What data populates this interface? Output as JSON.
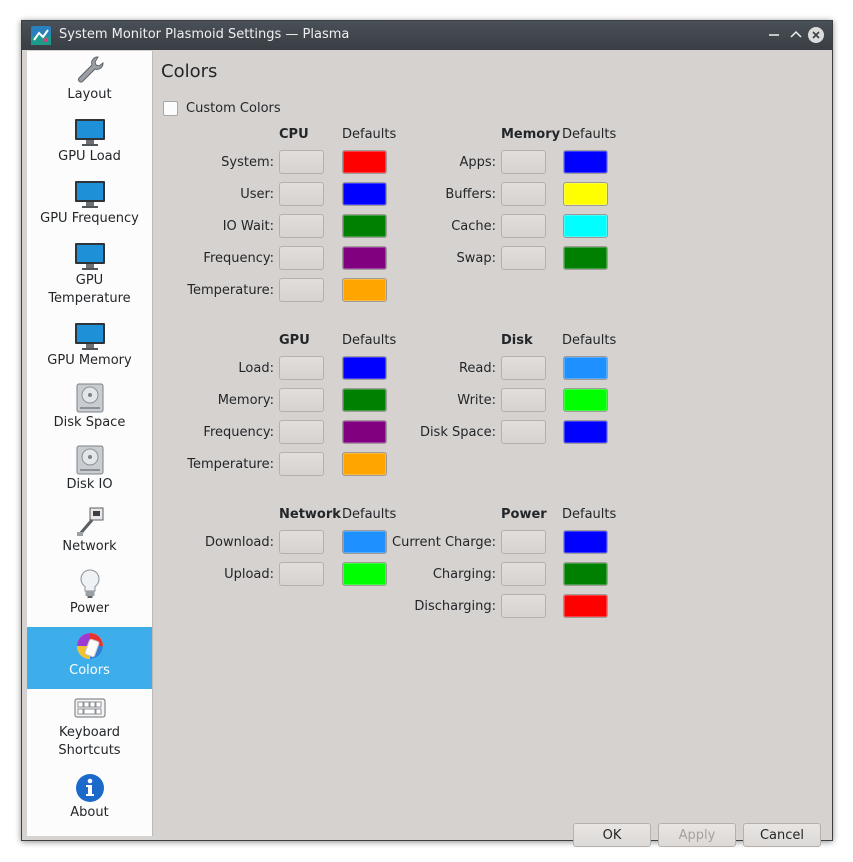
{
  "window": {
    "title": "System Monitor Plasmoid Settings — Plasma"
  },
  "sidebar": {
    "items": [
      {
        "label": "Layout",
        "icon": "wrench-icon",
        "active": false
      },
      {
        "label": "GPU Load",
        "icon": "monitor-icon",
        "active": false
      },
      {
        "label": "GPU Frequency",
        "icon": "monitor-icon",
        "active": false
      },
      {
        "label": "GPU\nTemperature",
        "icon": "monitor-icon",
        "active": false
      },
      {
        "label": "GPU Memory",
        "icon": "monitor-icon",
        "active": false
      },
      {
        "label": "Disk Space",
        "icon": "hard-drive-icon",
        "active": false
      },
      {
        "label": "Disk IO",
        "icon": "hard-drive-icon",
        "active": false
      },
      {
        "label": "Network",
        "icon": "network-cable-icon",
        "active": false
      },
      {
        "label": "Power",
        "icon": "lightbulb-icon",
        "active": false
      },
      {
        "label": "Colors",
        "icon": "color-palette-icon",
        "active": true
      },
      {
        "label": "Keyboard\nShortcuts",
        "icon": "keyboard-icon",
        "active": false
      },
      {
        "label": "About",
        "icon": "info-icon",
        "active": false
      }
    ]
  },
  "main": {
    "title": "Colors",
    "custom_colors_label": "Custom Colors",
    "custom_colors_checked": false,
    "defaults_header": "Defaults",
    "groups": {
      "cpu": {
        "header": "CPU",
        "rows": [
          {
            "label": "System:",
            "default_color": "#ff0000"
          },
          {
            "label": "User:",
            "default_color": "#0000ff"
          },
          {
            "label": "IO Wait:",
            "default_color": "#008000"
          },
          {
            "label": "Frequency:",
            "default_color": "#800080"
          },
          {
            "label": "Temperature:",
            "default_color": "#ffa500"
          }
        ]
      },
      "memory": {
        "header": "Memory",
        "rows": [
          {
            "label": "Apps:",
            "default_color": "#0000ff"
          },
          {
            "label": "Buffers:",
            "default_color": "#ffff00"
          },
          {
            "label": "Cache:",
            "default_color": "#00ffff"
          },
          {
            "label": "Swap:",
            "default_color": "#008000"
          }
        ]
      },
      "gpu": {
        "header": "GPU",
        "rows": [
          {
            "label": "Load:",
            "default_color": "#0000ff"
          },
          {
            "label": "Memory:",
            "default_color": "#008000"
          },
          {
            "label": "Frequency:",
            "default_color": "#800080"
          },
          {
            "label": "Temperature:",
            "default_color": "#ffa500"
          }
        ]
      },
      "disk": {
        "header": "Disk",
        "rows": [
          {
            "label": "Read:",
            "default_color": "#1e90ff"
          },
          {
            "label": "Write:",
            "default_color": "#00ff00"
          },
          {
            "label": "Disk Space:",
            "default_color": "#0000ff"
          }
        ]
      },
      "network": {
        "header": "Network",
        "rows": [
          {
            "label": "Download:",
            "default_color": "#1e90ff"
          },
          {
            "label": "Upload:",
            "default_color": "#00ff00"
          }
        ]
      },
      "power": {
        "header": "Power",
        "rows": [
          {
            "label": "Current Charge:",
            "default_color": "#0000ff"
          },
          {
            "label": "Charging:",
            "default_color": "#008000"
          },
          {
            "label": "Discharging:",
            "default_color": "#ff0000"
          }
        ]
      }
    }
  },
  "buttons": {
    "ok": "OK",
    "apply": "Apply",
    "cancel": "Cancel"
  }
}
